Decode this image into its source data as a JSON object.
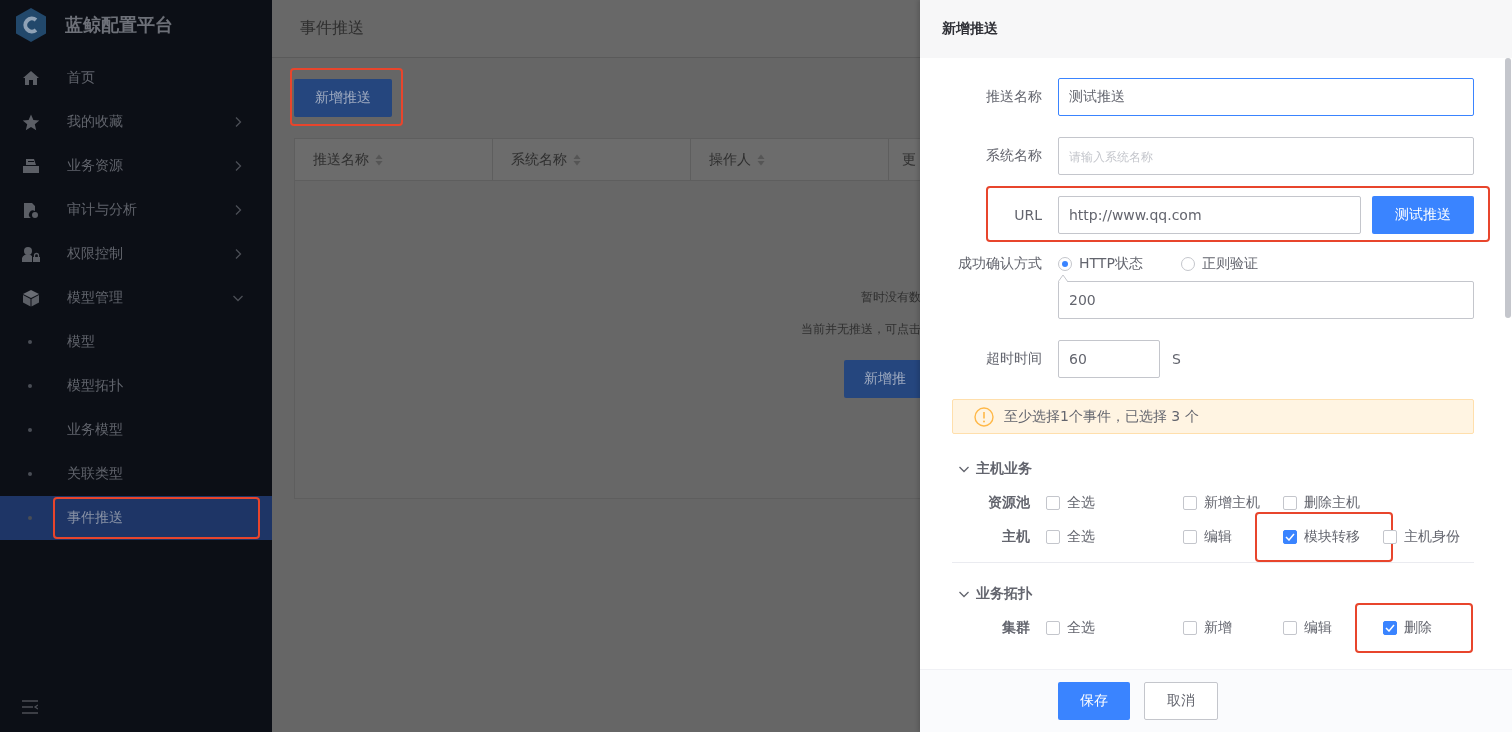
{
  "app": {
    "title": "蓝鲸配置平台"
  },
  "sidebar": {
    "items": [
      {
        "kind": "link",
        "label": "首页",
        "selected": false
      },
      {
        "kind": "group",
        "label": "我的收藏",
        "expanded": false
      },
      {
        "kind": "group",
        "label": "业务资源",
        "expanded": false
      },
      {
        "kind": "group",
        "label": "审计与分析",
        "expanded": false
      },
      {
        "kind": "group",
        "label": "权限控制",
        "expanded": false
      },
      {
        "kind": "group",
        "label": "模型管理",
        "expanded": true,
        "children": [
          {
            "label": "模型",
            "selected": false,
            "highlighted": false
          },
          {
            "label": "模型拓扑",
            "selected": false,
            "highlighted": false
          },
          {
            "label": "业务模型",
            "selected": false,
            "highlighted": false
          },
          {
            "label": "关联类型",
            "selected": false,
            "highlighted": false
          },
          {
            "label": "事件推送",
            "selected": true,
            "highlighted": true
          }
        ]
      }
    ]
  },
  "main": {
    "title": "事件推送",
    "add_button": {
      "label": "新增推送",
      "highlighted": true
    },
    "table": {
      "columns": [
        {
          "label": "推送名称",
          "sortable": true
        },
        {
          "label": "系统名称",
          "sortable": true
        },
        {
          "label": "操作人",
          "sortable": true
        },
        {
          "label": "更"
        }
      ],
      "empty": {
        "title": "暂时没有数",
        "message": "当前并无推送，可点击",
        "button": "新增推"
      }
    }
  },
  "drawer": {
    "title": "新增推送",
    "fields": [
      {
        "kind": "text",
        "label": "推送名称",
        "value": "测试推送",
        "focused": true
      },
      {
        "kind": "text",
        "label": "系统名称",
        "placeholder": "请输入系统名称",
        "focused": false
      },
      {
        "kind": "url",
        "label": "URL",
        "value": "http://www.qq.com",
        "button": "测试推送",
        "highlighted": true
      },
      {
        "kind": "radio",
        "label": "成功确认方式",
        "options": [
          {
            "label": "HTTP状态",
            "selected": true
          },
          {
            "label": "正则验证",
            "selected": false
          }
        ],
        "value": "200"
      },
      {
        "kind": "number",
        "label": "超时时间",
        "value": "60",
        "unit": "S"
      }
    ],
    "alert": {
      "text": "至少选择1个事件，已选择 3 个"
    },
    "event_groups": [
      {
        "title": "主机业务",
        "expanded": true,
        "rows": [
          {
            "label": "资源池",
            "options": [
              {
                "label": "全选",
                "checked": false,
                "highlighted": false
              },
              {
                "label": "新增主机",
                "checked": false,
                "highlighted": false
              },
              {
                "label": "删除主机",
                "checked": false,
                "highlighted": false
              }
            ]
          },
          {
            "label": "主机",
            "options": [
              {
                "label": "全选",
                "checked": false,
                "highlighted": false
              },
              {
                "label": "编辑",
                "checked": false,
                "highlighted": false
              },
              {
                "label": "模块转移",
                "checked": true,
                "highlighted": true
              },
              {
                "label": "主机身份",
                "checked": false,
                "highlighted": false
              }
            ]
          }
        ]
      },
      {
        "title": "业务拓扑",
        "expanded": true,
        "rows": [
          {
            "label": "集群",
            "options": [
              {
                "label": "全选",
                "checked": false,
                "highlighted": false
              },
              {
                "label": "新增",
                "checked": false,
                "highlighted": false
              },
              {
                "label": "编辑",
                "checked": false,
                "highlighted": false
              },
              {
                "label": "删除",
                "checked": true,
                "highlighted": true
              }
            ]
          }
        ]
      }
    ],
    "footer": {
      "buttons": [
        {
          "label": "保存",
          "kind": "primary"
        },
        {
          "label": "取消",
          "kind": "default"
        }
      ]
    }
  }
}
